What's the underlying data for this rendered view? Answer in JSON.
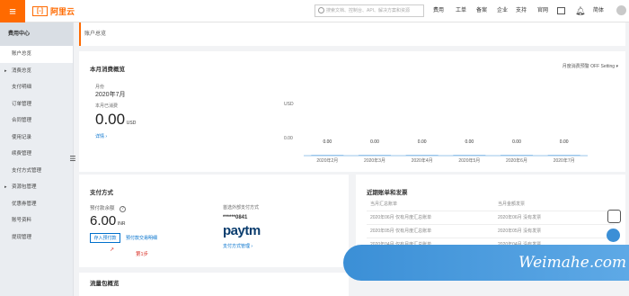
{
  "topbar": {
    "logo_text": "阿里云",
    "search_placeholder": "搜索文档、控制台、API、解决方案和资源",
    "nav": [
      "费用",
      "工单",
      "备案",
      "企业",
      "支持",
      "官网"
    ],
    "user": "简体"
  },
  "sidebar": {
    "title": "费用中心",
    "items": [
      {
        "label": "账户总览",
        "active": true,
        "caret": false
      },
      {
        "label": "消费总览",
        "active": false,
        "caret": true
      },
      {
        "label": "支付明细",
        "active": false,
        "caret": false
      },
      {
        "label": "订单管理",
        "active": false,
        "caret": false
      },
      {
        "label": "合同管理",
        "active": false,
        "caret": false
      },
      {
        "label": "使用记录",
        "active": false,
        "caret": false
      },
      {
        "label": "续费管理",
        "active": false,
        "caret": false
      },
      {
        "label": "支付方式管理",
        "active": false,
        "caret": false
      },
      {
        "label": "资源包管理",
        "active": false,
        "caret": true
      },
      {
        "label": "优惠券管理",
        "active": false,
        "caret": false
      },
      {
        "label": "账号资料",
        "active": false,
        "caret": false
      },
      {
        "label": "提现管理",
        "active": false,
        "caret": false
      }
    ]
  },
  "breadcrumb": "账户总览",
  "monthly": {
    "title": "本月消费概览",
    "setting_link": "月度消费预警 OFF Setting",
    "month_label": "月份",
    "month_value": "2020年7月",
    "spent_label": "本月已消费",
    "amount": "0.00",
    "currency": "USD",
    "details_link": "详情"
  },
  "chart_data": {
    "type": "bar",
    "ylabel": "USD",
    "categories": [
      "2020年2月",
      "2020年3月",
      "2020年4月",
      "2020年5月",
      "2020年6月",
      "2020年7月"
    ],
    "values": [
      0.0,
      0.0,
      0.0,
      0.0,
      0.0,
      0.0
    ],
    "value_labels": [
      "0.00",
      "0.00",
      "0.00",
      "0.00",
      "0.00",
      "0.00"
    ],
    "y_tick": "0.00",
    "bar_color": "#7fb8e8"
  },
  "payment": {
    "title": "支付方式",
    "prepaid_label": "预付款余额",
    "prepaid_amount": "6.00",
    "prepaid_currency": "INR",
    "deposit_button": "存入预付款",
    "details_link": "预付款交易明细",
    "annotation": "第1步",
    "ext_label": "首选外部支付方式",
    "card_number": "******0841",
    "paytm": "paytm",
    "manage_link": "支付方式管理"
  },
  "bills": {
    "title": "近期账单和发票",
    "col1": "当月汇总账单",
    "col2": "当月金额发票",
    "rows": [
      {
        "a": "2020年06月 仅有月度汇总账单",
        "b": "2020年06月 没有发票"
      },
      {
        "a": "2020年05月 仅有月度汇总账单",
        "b": "2020年05月 没有发票"
      },
      {
        "a": "2020年04月 仅有月度汇总账单",
        "b": "2020年04月 没有发票"
      }
    ]
  },
  "package": {
    "title": "流量包概览"
  },
  "watermark": "Weimahe.com",
  "colors": {
    "brand": "#ff6a00",
    "link": "#0070cc",
    "annotation": "#d93026"
  }
}
